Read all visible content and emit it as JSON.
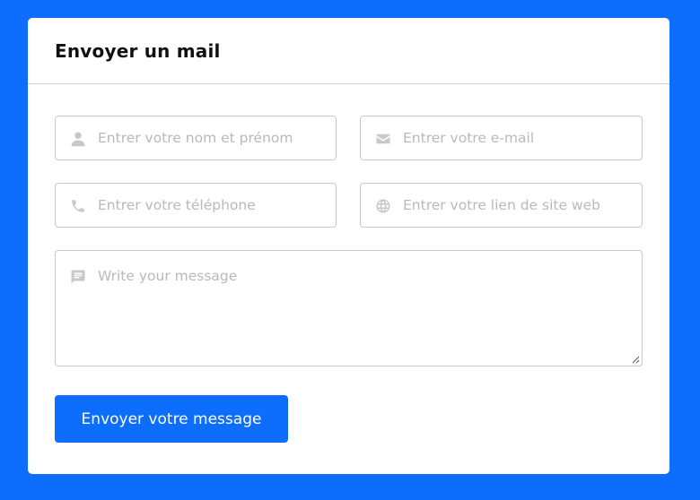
{
  "form": {
    "title": "Envoyer un mail",
    "name_placeholder": "Entrer votre nom et prénom",
    "email_placeholder": "Entrer votre e-mail",
    "phone_placeholder": "Entrer votre téléphone",
    "website_placeholder": "Entrer votre lien de site web",
    "message_placeholder": "Write your message",
    "submit_label": "Envoyer votre message"
  },
  "icons": {
    "name": "user-icon",
    "email": "envelope-icon",
    "phone": "phone-icon",
    "website": "globe-icon",
    "message": "message-icon"
  },
  "colors": {
    "background": "#0d6efd",
    "card": "#ffffff",
    "button": "#0d6efd",
    "icon": "#c8c8c8",
    "placeholder": "#b9b9b9",
    "border": "#c9c9c9"
  }
}
